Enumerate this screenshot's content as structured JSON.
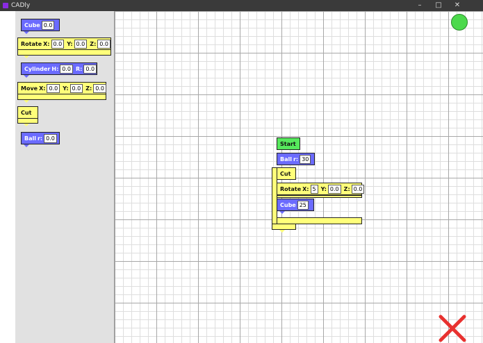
{
  "window": {
    "title": "CADly",
    "minimize": "–",
    "maximize": "□",
    "close": "✕"
  },
  "palette": {
    "cube": {
      "label": "Cube",
      "value": "0.0"
    },
    "rotate": {
      "label": "Rotate",
      "x_label": "X:",
      "x": "0.0",
      "y_label": "Y:",
      "y": "0.0",
      "z_label": "Z:",
      "z": "0.0"
    },
    "cylinder": {
      "label": "Cylinder",
      "h_label": "H:",
      "h": "0.0",
      "r_label": "R:",
      "r": "0.0"
    },
    "move": {
      "label": "Move",
      "x_label": "X:",
      "x": "0.0",
      "y_label": "Y:",
      "y": "0.0",
      "z_label": "Z:",
      "z": "0.0"
    },
    "cut": {
      "label": "Cut"
    },
    "ball": {
      "label": "Ball",
      "r_label": "r:",
      "r": "0.0"
    }
  },
  "program": {
    "start": {
      "label": "Start"
    },
    "ball": {
      "label": "Ball",
      "r_label": "r:",
      "r": "30"
    },
    "cut": {
      "label": "Cut"
    },
    "rotate": {
      "label": "Rotate",
      "x_label": "X:",
      "x": "5",
      "y_label": "Y:",
      "y": "0.0",
      "z_label": "Z:",
      "z": "0.0"
    },
    "cube": {
      "label": "Cube",
      "value": "25"
    }
  },
  "colors": {
    "shape_block": "#6b6bff",
    "transform_block": "#ffff7a",
    "start_block": "#56e85c",
    "run_indicator": "#4cd94c",
    "delete_icon": "#e8312f"
  },
  "icons": {
    "status": "green-circle-icon",
    "trash": "red-x-icon"
  }
}
